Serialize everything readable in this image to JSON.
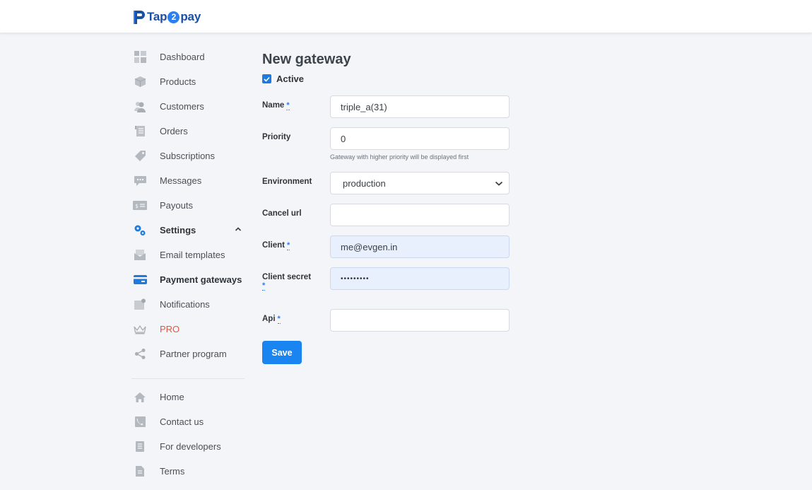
{
  "brand": {
    "name_prefix": "Tap",
    "name_digit": "2",
    "name_suffix": "pay",
    "color": "#1a4fa3",
    "accent": "#2d7ff0"
  },
  "sidebar": {
    "items": [
      {
        "label": "Dashboard",
        "icon": "dashboard-icon"
      },
      {
        "label": "Products",
        "icon": "box-icon"
      },
      {
        "label": "Customers",
        "icon": "users-icon"
      },
      {
        "label": "Orders",
        "icon": "receipt-icon"
      },
      {
        "label": "Subscriptions",
        "icon": "tag-icon"
      },
      {
        "label": "Messages",
        "icon": "chat-icon"
      },
      {
        "label": "Payouts",
        "icon": "money-icon"
      },
      {
        "label": "Settings",
        "icon": "gears-icon",
        "expanded": true
      },
      {
        "label": "Email templates",
        "icon": "envelope-icon"
      },
      {
        "label": "Payment gateways",
        "icon": "credit-card-icon",
        "active": true
      },
      {
        "label": "Notifications",
        "icon": "bell-icon"
      },
      {
        "label": "PRO",
        "icon": "crown-icon",
        "color": "#e0573c"
      },
      {
        "label": "Partner program",
        "icon": "share-icon"
      }
    ],
    "footer_items": [
      {
        "label": "Home",
        "icon": "home-icon"
      },
      {
        "label": "Contact us",
        "icon": "phone-icon"
      },
      {
        "label": "For developers",
        "icon": "document-icon"
      },
      {
        "label": "Terms",
        "icon": "file-icon"
      }
    ]
  },
  "form": {
    "title": "New gateway",
    "active_label": "Active",
    "active_checked": true,
    "required_mark": "*",
    "fields": {
      "name": {
        "label": "Name",
        "value": "triple_a(31)"
      },
      "priority": {
        "label": "Priority",
        "value": "0",
        "helper": "Gateway with higher priority will be displayed first"
      },
      "environment": {
        "label": "Environment",
        "value": "production"
      },
      "cancel_url": {
        "label": "Cancel url",
        "value": ""
      },
      "client": {
        "label": "Client",
        "value": "me@evgen.in"
      },
      "client_secret": {
        "label": "Client secret",
        "value": "•••••••••"
      },
      "api": {
        "label": "Api",
        "value": ""
      }
    },
    "save_label": "Save"
  }
}
